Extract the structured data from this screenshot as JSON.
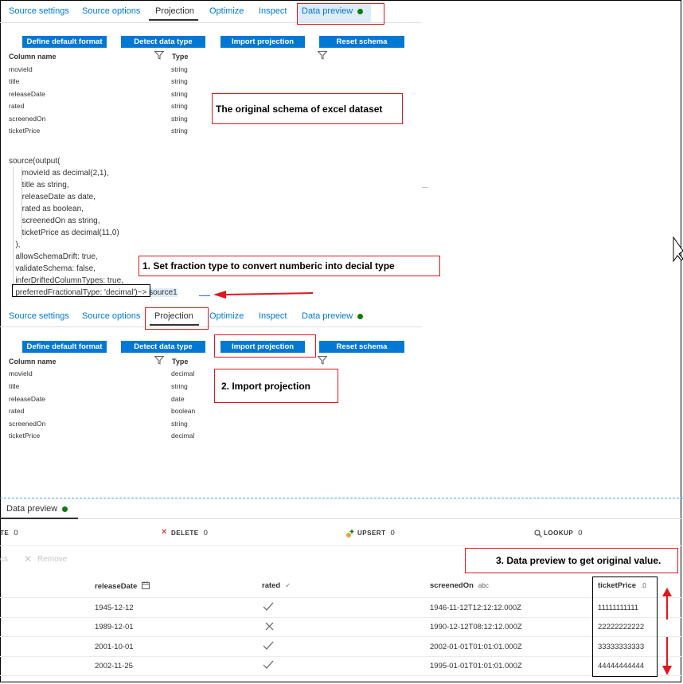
{
  "tabs_top": {
    "items": [
      "Source settings",
      "Source options",
      "Projection",
      "Optimize",
      "Inspect",
      "Data preview"
    ],
    "active": "Projection"
  },
  "buttons": {
    "define_default_format": "Define default format",
    "detect_data_type": "Detect data type",
    "import_projection": "Import projection",
    "reset_schema": "Reset schema"
  },
  "schema_headers": {
    "column_name": "Column name",
    "type": "Type"
  },
  "schema_original": [
    {
      "name": "movieId",
      "type": "string"
    },
    {
      "name": "title",
      "type": "string"
    },
    {
      "name": "releaseDate",
      "type": "string"
    },
    {
      "name": "rated",
      "type": "string"
    },
    {
      "name": "screenedOn",
      "type": "string"
    },
    {
      "name": "ticketPrice",
      "type": "string"
    }
  ],
  "annotations": {
    "original_schema": "The original schema of excel dataset",
    "step1": "1. Set fraction type to convert numberic into decial type",
    "step2": "2. Import projection",
    "step3": "3. Data preview to get original value."
  },
  "code_lines": [
    "source(output(",
    "      movieId as decimal(2,1),",
    "      title as string,",
    "      releaseDate as date,",
    "      rated as boolean,",
    "      screenedOn as string,",
    "      ticketPrice as decimal(11,0)",
    "   ),",
    "   allowSchemaDrift: true,",
    "   validateSchema: false,",
    "   inferDriftedColumnTypes: true,",
    "   preferredFractionalType: 'decimal')"
  ],
  "code_tail": "~> ",
  "code_source_name": "source1",
  "tabs_mid": {
    "items": [
      "Source settings",
      "Source options",
      "Projection",
      "Optimize",
      "Inspect",
      "Data preview"
    ],
    "active": "Projection"
  },
  "schema_imported": [
    {
      "name": "movieId",
      "type": "decimal"
    },
    {
      "name": "title",
      "type": "string"
    },
    {
      "name": "releaseDate",
      "type": "date"
    },
    {
      "name": "rated",
      "type": "boolean"
    },
    {
      "name": "screenedOn",
      "type": "string"
    },
    {
      "name": "ticketPrice",
      "type": "decimal"
    }
  ],
  "data_preview": {
    "tab_label": "Data preview",
    "stats": [
      {
        "label": "TE",
        "value": "0"
      },
      {
        "label": "DELETE",
        "value": "0"
      },
      {
        "label": "UPSERT",
        "value": "0"
      },
      {
        "label": "LOOKUP",
        "value": "0"
      }
    ],
    "faded_left": "cs",
    "remove_label": "Remove",
    "columns": [
      {
        "label": "releaseDate",
        "type_hint": "calendar-icon"
      },
      {
        "label": "rated",
        "type_hint": "boolean-icon"
      },
      {
        "label": "screenedOn",
        "type_hint": "abc"
      },
      {
        "label": "ticketPrice",
        "type_hint": "decimal-icon"
      }
    ],
    "rows": [
      {
        "releaseDate": "1945-12-12",
        "rated": "check",
        "screenedOn": "1946-11-12T12:12:12.000Z",
        "ticketPrice": "11111111111"
      },
      {
        "releaseDate": "1989-12-01",
        "rated": "cross",
        "screenedOn": "1990-12-12T08:12:12.000Z",
        "ticketPrice": "22222222222"
      },
      {
        "releaseDate": "2001-10-01",
        "rated": "check",
        "screenedOn": "2002-01-01T01:01:01.000Z",
        "ticketPrice": "33333333333"
      },
      {
        "releaseDate": "2002-11-25",
        "rated": "check",
        "screenedOn": "1995-01-01T01:01:01.000Z",
        "ticketPrice": "44444444444"
      }
    ]
  },
  "colors": {
    "accent": "#0078d4",
    "annotation_red": "#e0161f",
    "status_green": "#107c10"
  }
}
